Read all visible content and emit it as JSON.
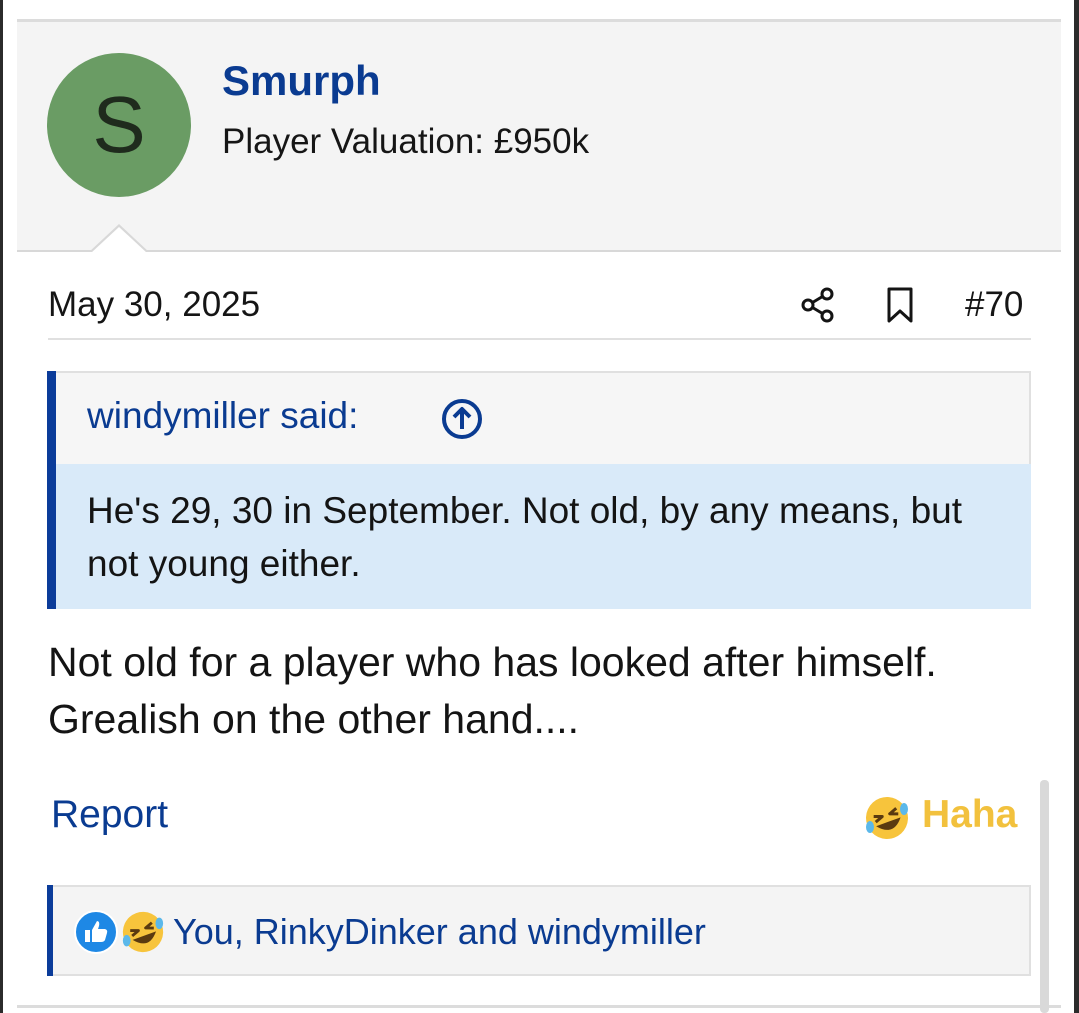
{
  "post": {
    "author": {
      "avatar_letter": "S",
      "name": "Smurph",
      "title": "Player Valuation: £950k",
      "avatar_color": "#6a9c64"
    },
    "meta": {
      "date": "May 30, 2025",
      "post_number": "#70"
    },
    "quote": {
      "header": "windymiller said:",
      "body": "He's 29, 30 in September. Not old, by any means, but not young either."
    },
    "message": "Not old for a player who has looked after himself. Grealish on the other hand....",
    "actions": {
      "report_label": "Report",
      "reaction_label": "Haha"
    },
    "reactions": {
      "summary": "You, RinkyDinker and windymiller"
    },
    "colors": {
      "link": "#0a3b91",
      "accent_bar": "#0b3c9a",
      "quote_bg": "#d9eaf9",
      "haha": "#f2c13d"
    },
    "icons": [
      "share-icon",
      "bookmark-icon",
      "quote-jump-icon",
      "haha-emoji-icon",
      "like-reaction-icon"
    ]
  }
}
